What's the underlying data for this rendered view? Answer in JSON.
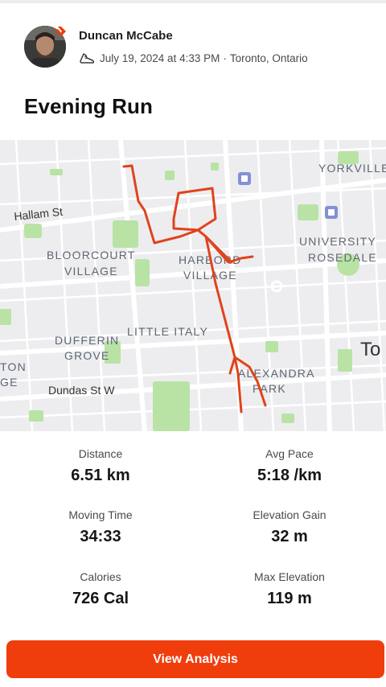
{
  "athlete": {
    "name": "Duncan McCabe",
    "date": "July 19, 2024 at 4:33 PM",
    "separator": "·",
    "location": "Toronto, Ontario",
    "activity_icon": "running-shoe-icon",
    "badge_icon": "strava-chevron-icon"
  },
  "activity": {
    "title": "Evening Run"
  },
  "map": {
    "labels": {
      "yorkville": "YORKVILLE",
      "hallam": "Hallam St",
      "bloorcourt1": "BLOORCOURT",
      "bloorcourt2": "VILLAGE",
      "harbord1": "HARBORD",
      "harbord2": "VILLAGE",
      "university": "UNIVERSITY",
      "rosedale": "ROSEDALE",
      "dufferin1": "DUFFERIN",
      "dufferin2": "GROVE",
      "little_italy": "LITTLE ITALY",
      "alexandra1": "ALEXANDRA",
      "alexandra2": "PARK",
      "dundas": "Dundas St W",
      "to": "To",
      "ton": "TON",
      "ge": "GE"
    },
    "route_color": "#e0431a",
    "park_color": "#b9e3a5"
  },
  "stats": {
    "distance": {
      "label": "Distance",
      "value": "6.51 km"
    },
    "avg_pace": {
      "label": "Avg Pace",
      "value": "5:18 /km"
    },
    "moving_time": {
      "label": "Moving Time",
      "value": "34:33"
    },
    "elevation_gain": {
      "label": "Elevation Gain",
      "value": "32 m"
    },
    "calories": {
      "label": "Calories",
      "value": "726 Cal"
    },
    "max_elevation": {
      "label": "Max Elevation",
      "value": "119 m"
    }
  },
  "cta": {
    "label": "View Analysis",
    "color": "#f03d0c"
  }
}
